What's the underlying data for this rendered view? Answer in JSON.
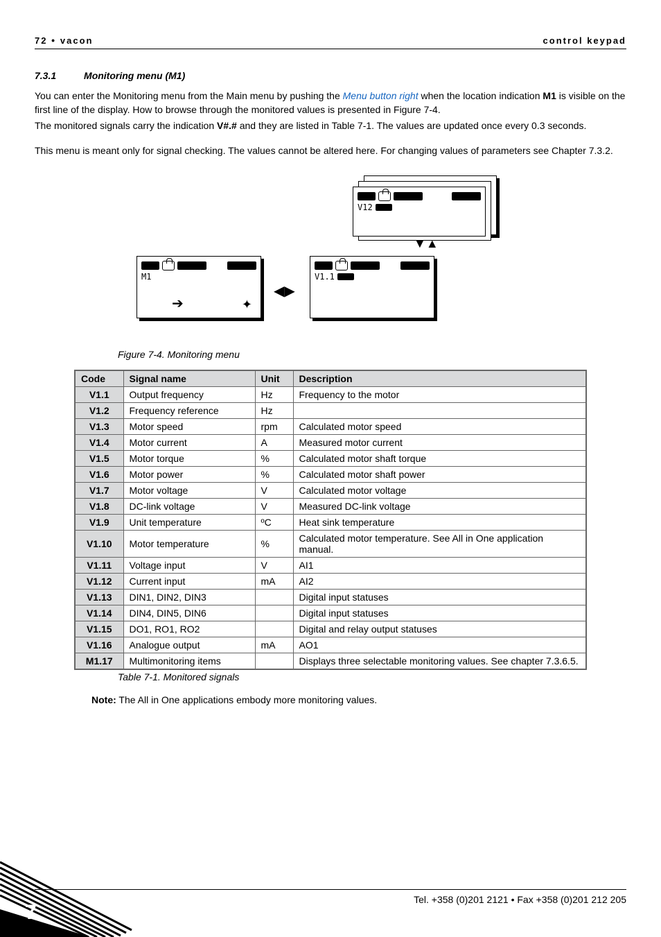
{
  "header": {
    "left_page": "72",
    "left_brand": "vacon",
    "right": "control keypad"
  },
  "section": {
    "number": "7.3.1",
    "title": "Monitoring menu (M1)"
  },
  "para": {
    "p1a": "You can enter the Monitoring menu from the Main menu by pushing the ",
    "p1_link": "Menu button right",
    "p1b": " when the location indication ",
    "p1_bold": "M1",
    "p1c": " is visible on the first line of the display. How to browse through the monitored values is presented in Figure 7-4.",
    "p2a": "The monitored signals carry the indication ",
    "p2_bold": "V#.#",
    "p2b": " and they are listed in Table 7-1. The values are updated once every 0.3 seconds.",
    "p3": "This menu is meant only for signal checking. The values cannot be altered here. For changing values of parameters see Chapter 7.3.2."
  },
  "figure_caption": "Figure 7-4. Monitoring menu",
  "table": {
    "headers": {
      "code": "Code",
      "sig": "Signal name",
      "unit": "Unit",
      "desc": "Description"
    },
    "rows": [
      {
        "code": "V1.1",
        "sig": "Output frequency",
        "unit": "Hz",
        "desc": "Frequency to the motor"
      },
      {
        "code": "V1.2",
        "sig": "Frequency reference",
        "unit": "Hz",
        "desc": ""
      },
      {
        "code": "V1.3",
        "sig": "Motor speed",
        "unit": "rpm",
        "desc": "Calculated motor speed"
      },
      {
        "code": "V1.4",
        "sig": "Motor current",
        "unit": "A",
        "desc": "Measured motor current"
      },
      {
        "code": "V1.5",
        "sig": "Motor torque",
        "unit": "%",
        "desc": "Calculated motor shaft torque"
      },
      {
        "code": "V1.6",
        "sig": "Motor power",
        "unit": "%",
        "desc": "Calculated motor shaft power"
      },
      {
        "code": "V1.7",
        "sig": "Motor voltage",
        "unit": "V",
        "desc": "Calculated motor voltage"
      },
      {
        "code": "V1.8",
        "sig": "DC-link voltage",
        "unit": "V",
        "desc": "Measured DC-link voltage"
      },
      {
        "code": "V1.9",
        "sig": "Unit temperature",
        "unit": "ºC",
        "desc": "Heat sink temperature"
      },
      {
        "code": "V1.10",
        "sig": "Motor temperature",
        "unit": "%",
        "desc": "Calculated motor temperature. See All in One application manual."
      },
      {
        "code": "V1.11",
        "sig": "Voltage input",
        "unit": "V",
        "desc": "AI1"
      },
      {
        "code": "V1.12",
        "sig": "Current input",
        "unit": "mA",
        "desc": "AI2"
      },
      {
        "code": "V1.13",
        "sig": "DIN1, DIN2, DIN3",
        "unit": "",
        "desc": "Digital input statuses"
      },
      {
        "code": "V1.14",
        "sig": "DIN4, DIN5, DIN6",
        "unit": "",
        "desc": "Digital input statuses"
      },
      {
        "code": "V1.15",
        "sig": "DO1, RO1, RO2",
        "unit": "",
        "desc": "Digital and relay output statuses"
      },
      {
        "code": "V1.16",
        "sig": "Analogue output",
        "unit": "mA",
        "desc": "AO1"
      },
      {
        "code": "M1.17",
        "sig": "Multimonitoring items",
        "unit": "",
        "desc": "Displays three selectable monitoring values. See chapter 7.3.6.5."
      }
    ]
  },
  "table_caption": "Table 7-1. Monitored signals",
  "note": {
    "label": "Note:",
    "text": " The All in One applications embody more monitoring values."
  },
  "footer": "Tel. +358 (0)201 2121 • Fax +358 (0)201 212 205",
  "chapter_number": "7",
  "fig": {
    "m1": "M1",
    "v12": "V12",
    "v11": "V1.1"
  }
}
